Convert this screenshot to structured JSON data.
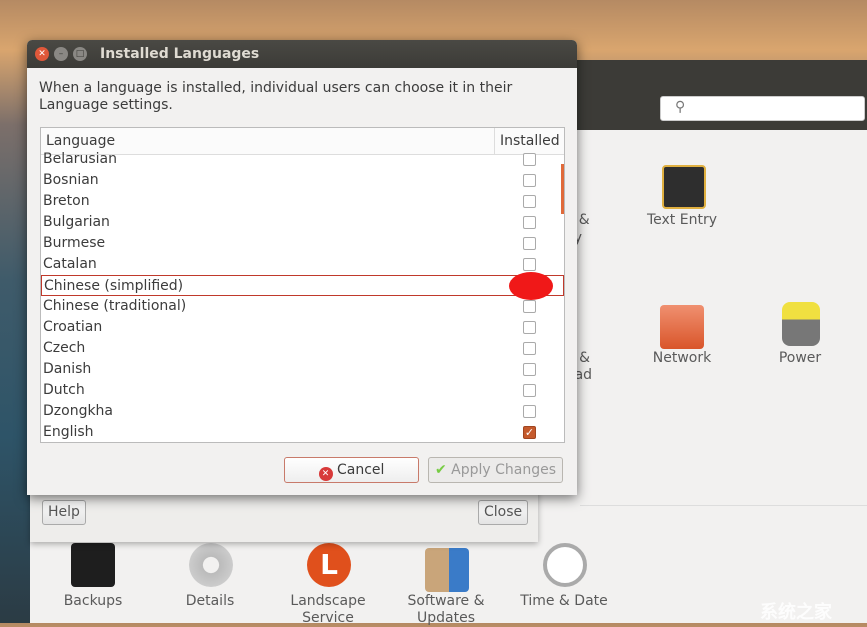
{
  "dialog": {
    "title": "Installed Languages",
    "description": "When a language is installed, individual users can choose it in their Language settings.",
    "columns": {
      "language": "Language",
      "installed": "Installed"
    },
    "languages": [
      {
        "name": "Belarusian",
        "installed": false
      },
      {
        "name": "Bosnian",
        "installed": false
      },
      {
        "name": "Breton",
        "installed": false
      },
      {
        "name": "Bulgarian",
        "installed": false
      },
      {
        "name": "Burmese",
        "installed": false
      },
      {
        "name": "Catalan",
        "installed": false
      },
      {
        "name": "Chinese (simplified)",
        "installed": false,
        "highlighted": true
      },
      {
        "name": "Chinese (traditional)",
        "installed": false
      },
      {
        "name": "Croatian",
        "installed": false
      },
      {
        "name": "Czech",
        "installed": false
      },
      {
        "name": "Danish",
        "installed": false
      },
      {
        "name": "Dutch",
        "installed": false
      },
      {
        "name": "Dzongkha",
        "installed": false
      },
      {
        "name": "English",
        "installed": true
      }
    ],
    "cancel_label": "Cancel",
    "apply_label": "Apply Changes",
    "accent": "#c55a2c"
  },
  "language_support": {
    "help_label": "Help",
    "close_label": "Close"
  },
  "settings": {
    "partial_labels": [
      "y &",
      "cy",
      "e &",
      "oad"
    ],
    "items": [
      {
        "label": "Text Entry",
        "icon": "keyboard-icon"
      },
      {
        "label": "Network",
        "icon": "network-folder-icon"
      },
      {
        "label": "Power",
        "icon": "battery-icon"
      },
      {
        "label": "Backups",
        "icon": "safe-icon"
      },
      {
        "label": "Details",
        "icon": "gear-icon"
      },
      {
        "label": "Landscape Service",
        "icon": "landscape-icon"
      },
      {
        "label": "Software & Updates",
        "icon": "software-globe-icon"
      },
      {
        "label": "Time & Date",
        "icon": "clock-icon"
      }
    ]
  },
  "watermark": "系统之家"
}
